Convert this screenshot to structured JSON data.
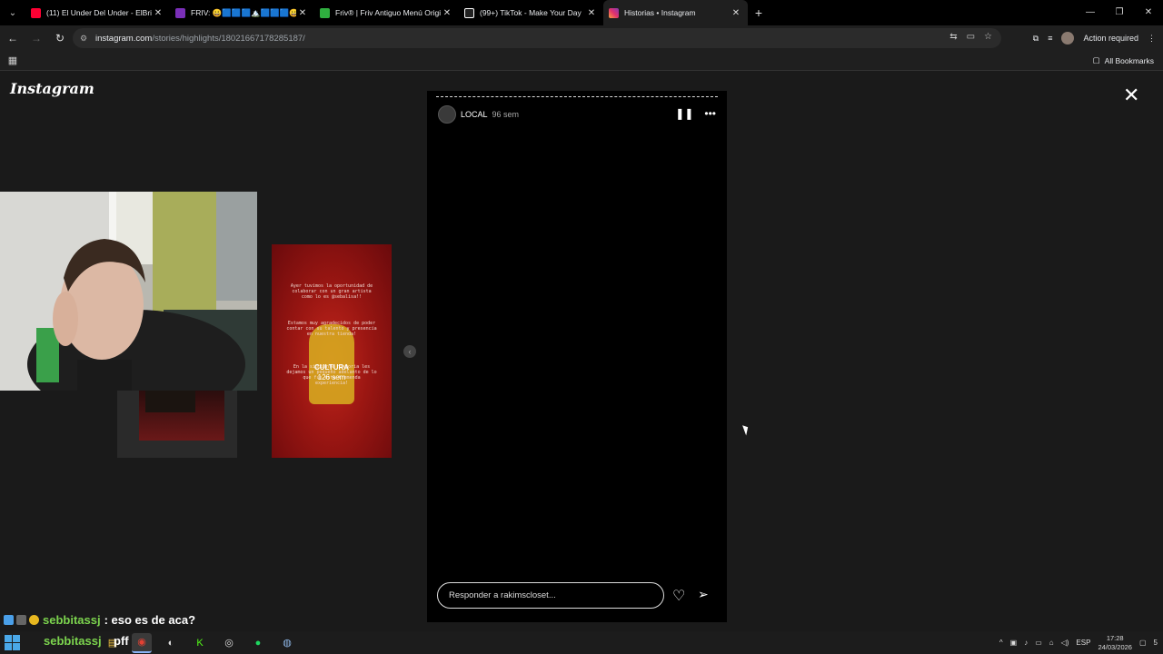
{
  "browser": {
    "tabs": [
      {
        "title": "(11) El Under Del Under - ElBrian",
        "favicon_color": "#ff0033",
        "icon": "youtube-icon"
      },
      {
        "title": "FRIV: 😀🟦🟦🟦🏔️🟦🟦🟦😀",
        "favicon_color": "#7a2fb8",
        "icon": "friv-icon"
      },
      {
        "title": "Friv® | Friv Antiguo Menú Original",
        "favicon_color": "#2fae3f",
        "icon": "friv-green-icon"
      },
      {
        "title": "(99+) TikTok - Make Your Day",
        "favicon_color": "#ffffff",
        "icon": "tiktok-icon"
      },
      {
        "title": "Historias • Instagram",
        "favicon_color": "#e1306c",
        "icon": "instagram-icon",
        "active": true
      }
    ],
    "new_tab": "+",
    "url_host": "instagram.com",
    "url_path": "/stories/highlights/18021667178285187/",
    "action_required": "Action required",
    "all_bookmarks": "All Bookmarks"
  },
  "instagram": {
    "logo": "Instagram",
    "close": "✕",
    "story": {
      "username": "LOCAL",
      "time_ago": "96 sem",
      "reply_placeholder": "Responder a rakimscloset..."
    },
    "next_card": {
      "text_top": "Ayer tuvimos la oportunidad de colaborar con un gran artista como lo es @sebalisa!!",
      "text_mid": "Estamos muy agradecidos de poder contar con su talento y presencia en nuestra tienda!",
      "text_bottom": "En la siguiente historia les dejamos un pequeño adelanto de lo que fue esta tremenda experiencia!",
      "username": "CULTURA",
      "time_ago": "126 sem"
    }
  },
  "stream_overlay": {
    "chat_user": "sebbitassj",
    "chat_message": ": eso es de aca?",
    "overlay_user": "sebbitassj",
    "overlay_rest": "pff"
  },
  "taskbar": {
    "language": "ESP",
    "time": "17:28",
    "date": "24/03/2026",
    "notifications": "5"
  }
}
